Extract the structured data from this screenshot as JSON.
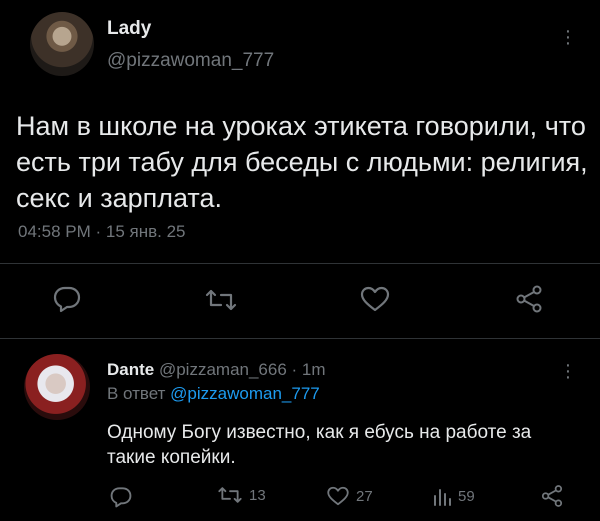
{
  "main_tweet": {
    "author_name": "Lady",
    "author_handle": "@pizzawoman_777",
    "text": "Нам в школе на уроках этикета говорили, что есть три табу для беседы с людьми: религия, секс и зарплата.",
    "timestamp": "04:58 PM · 15 янв. 25",
    "actions": {
      "reply_icon": "reply-icon",
      "retweet_icon": "retweet-icon",
      "like_icon": "like-icon",
      "share_icon": "share-icon"
    }
  },
  "reply_tweet": {
    "author_name": "Dante",
    "meta": "@pizzaman_666 · 1m",
    "reply_prefix": "В ответ ",
    "reply_mention": "@pizzawoman_777",
    "text": "Одному Богу известно, как я ебусь на работе за такие копейки.",
    "counts": {
      "retweets": "13",
      "likes": "27",
      "views": "59"
    }
  },
  "colors": {
    "background": "#000000",
    "text": "#e7e9ea",
    "muted": "#71767b",
    "accent": "#1d9bf0",
    "divider": "#2f3336"
  }
}
